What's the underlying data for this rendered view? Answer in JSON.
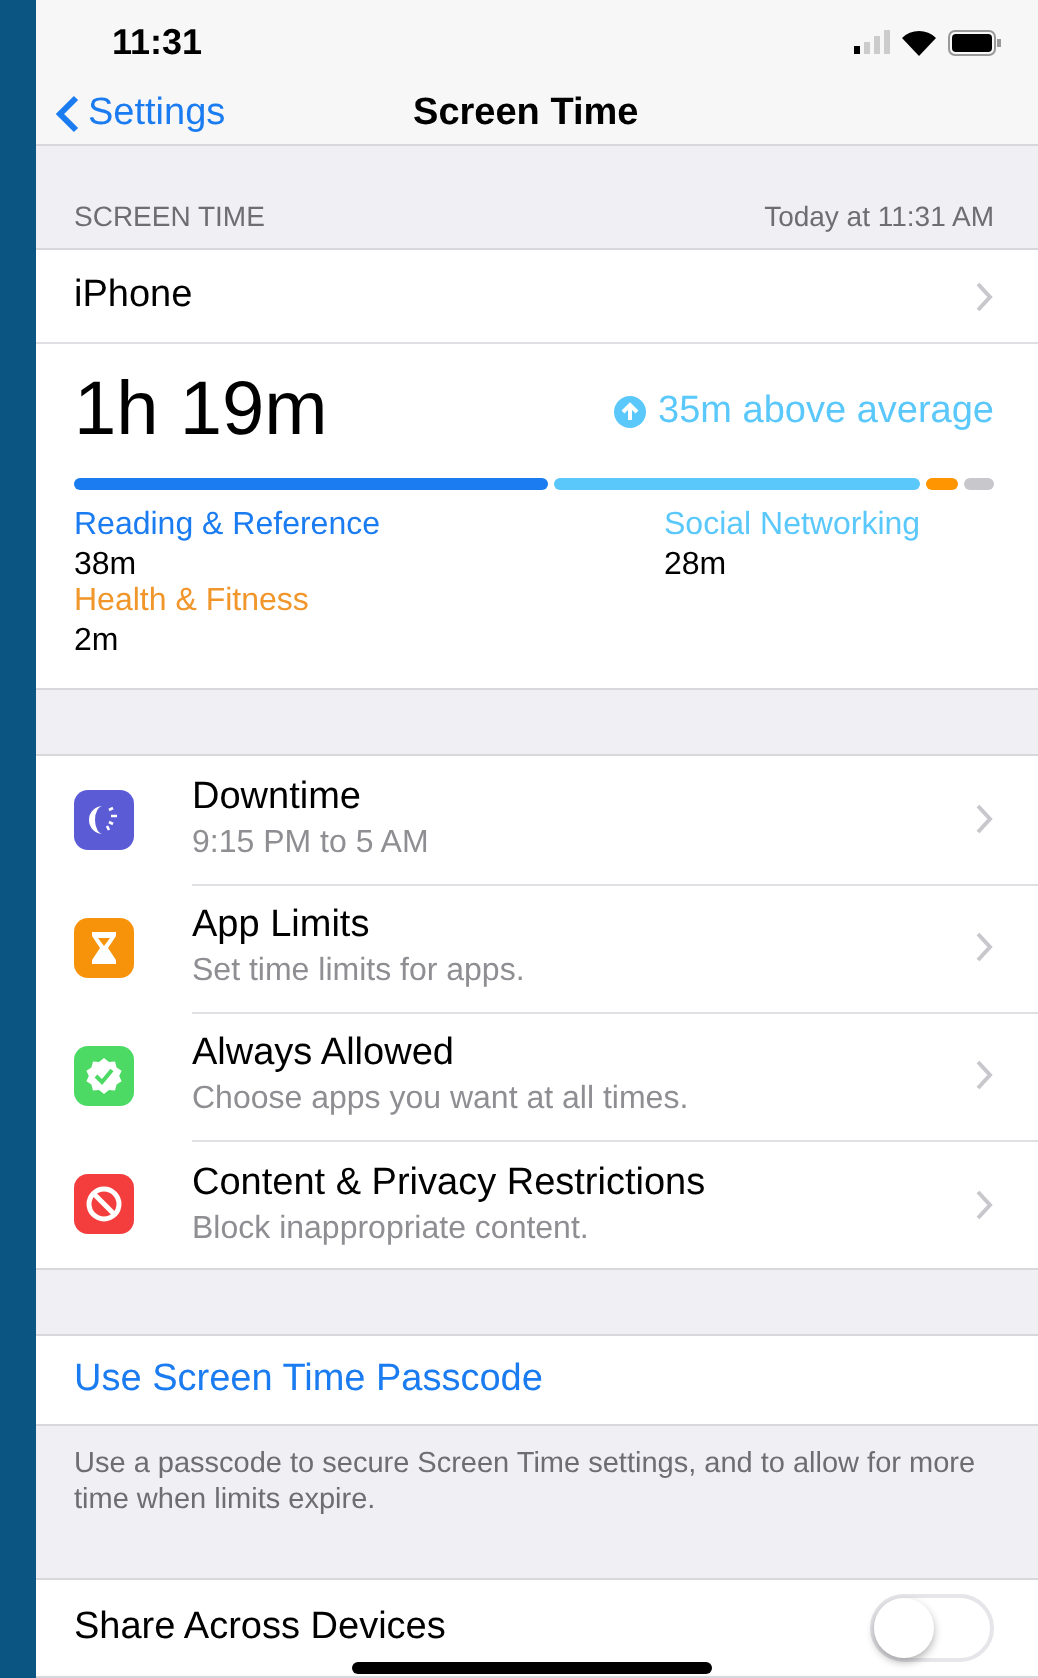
{
  "status_bar": {
    "time": "11:31"
  },
  "nav": {
    "back": "Settings",
    "title": "Screen Time"
  },
  "section_header": {
    "title": "SCREEN TIME",
    "date": "Today at 11:31 AM"
  },
  "device": {
    "name": "iPhone"
  },
  "summary": {
    "total": "1h 19m",
    "trend": "35m above average",
    "segments": [
      {
        "color": "#1a7cf0"
      },
      {
        "color": "#5ac8fa"
      },
      {
        "color": "#ff9500"
      },
      {
        "color": "#c7c7cc"
      }
    ],
    "categories": [
      {
        "name": "Reading & Reference",
        "time": "38m",
        "color": "#1a7cf0"
      },
      {
        "name": "Social Networking",
        "time": "28m",
        "color": "#5ac8fa"
      },
      {
        "name": "Health & Fitness",
        "time": "2m",
        "color": "#f0962a"
      }
    ]
  },
  "menu": [
    {
      "kind": "downtime",
      "title": "Downtime",
      "subtitle": "9:15 PM to 5 AM",
      "color": "#5b5bd6"
    },
    {
      "kind": "limits",
      "title": "App Limits",
      "subtitle": "Set time limits for apps.",
      "color": "#f7930a"
    },
    {
      "kind": "allowed",
      "title": "Always Allowed",
      "subtitle": "Choose apps you want at all times.",
      "color": "#4cd964"
    },
    {
      "kind": "restrictions",
      "title": "Content & Privacy Restrictions",
      "subtitle": "Block inappropriate content.",
      "color": "#f43d3d"
    }
  ],
  "passcode": {
    "label": "Use Screen Time Passcode",
    "footnote": "Use a passcode to secure Screen Time settings, and to allow for more time when limits expire."
  },
  "share": {
    "label": "Share Across Devices",
    "on": false
  }
}
